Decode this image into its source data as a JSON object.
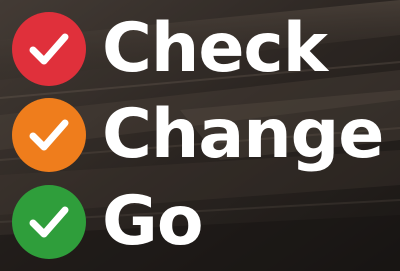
{
  "steps": [
    {
      "word": "Check",
      "color": "#e0303b",
      "icon": "checkmark-icon"
    },
    {
      "word": "Change",
      "color": "#ef7d1c",
      "icon": "checkmark-icon"
    },
    {
      "word": "Go",
      "color": "#2f9e3b",
      "icon": "checkmark-icon"
    }
  ]
}
